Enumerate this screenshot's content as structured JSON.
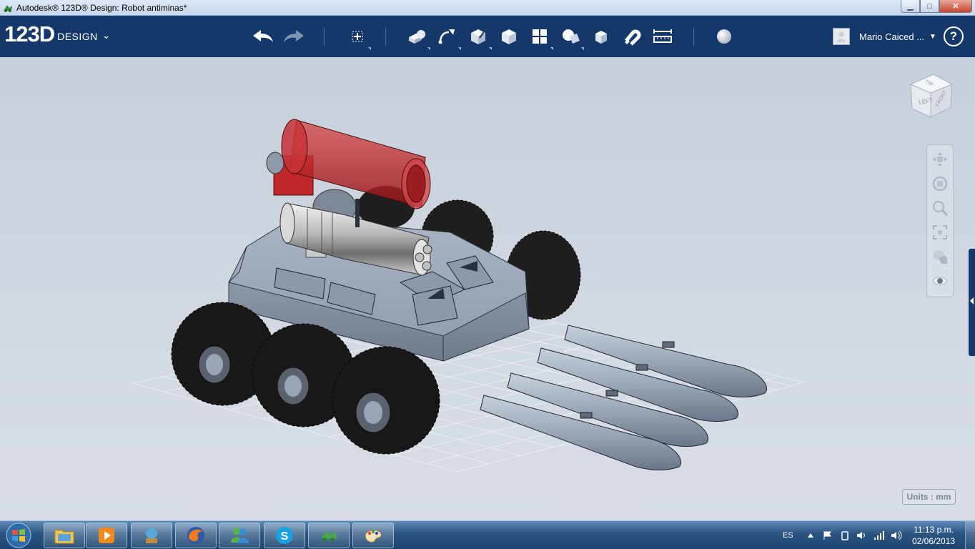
{
  "window": {
    "title": "Autodesk® 123D® Design: Robot antiminas*",
    "controls": {
      "minimize": "▁",
      "maximize": "□",
      "close": "✕"
    }
  },
  "toolbar": {
    "logo_number": "123D",
    "logo_word": "DESIGN",
    "logo_caret": "⌄",
    "tools": [
      "undo-icon",
      "redo-icon",
      "transform-icon",
      "primitives-icon",
      "sketch-icon",
      "construct-icon",
      "modify-icon",
      "pattern-icon",
      "grouping-icon",
      "combine-icon",
      "snap-icon",
      "measure-icon",
      "material-icon"
    ],
    "user_name": "Mario Caiced ...",
    "user_caret": "▼",
    "help_label": "?"
  },
  "viewcube": {
    "face_top": "TOP",
    "face_left": "LEFT",
    "face_front": "FRONT"
  },
  "navbar": [
    "pan-icon",
    "orbit-icon",
    "zoom-icon",
    "fit-icon",
    "view-style-icon",
    "visibility-icon"
  ],
  "units_label": "Units : mm",
  "colors": {
    "toolbar": "#14386a",
    "viewport": "#cdd4de",
    "model": "#9aa7b6",
    "tire": "#1c1c1c",
    "canister": "#c0232a"
  },
  "taskbar": {
    "items": [
      "explorer-icon",
      "media-player-icon",
      "network-icon",
      "firefox-icon",
      "messenger-icon",
      "skype-icon",
      "123d-icon",
      "paint-icon"
    ],
    "tray_lang": "ES",
    "time": "11:13 p.m.",
    "date": "02/06/2013"
  }
}
